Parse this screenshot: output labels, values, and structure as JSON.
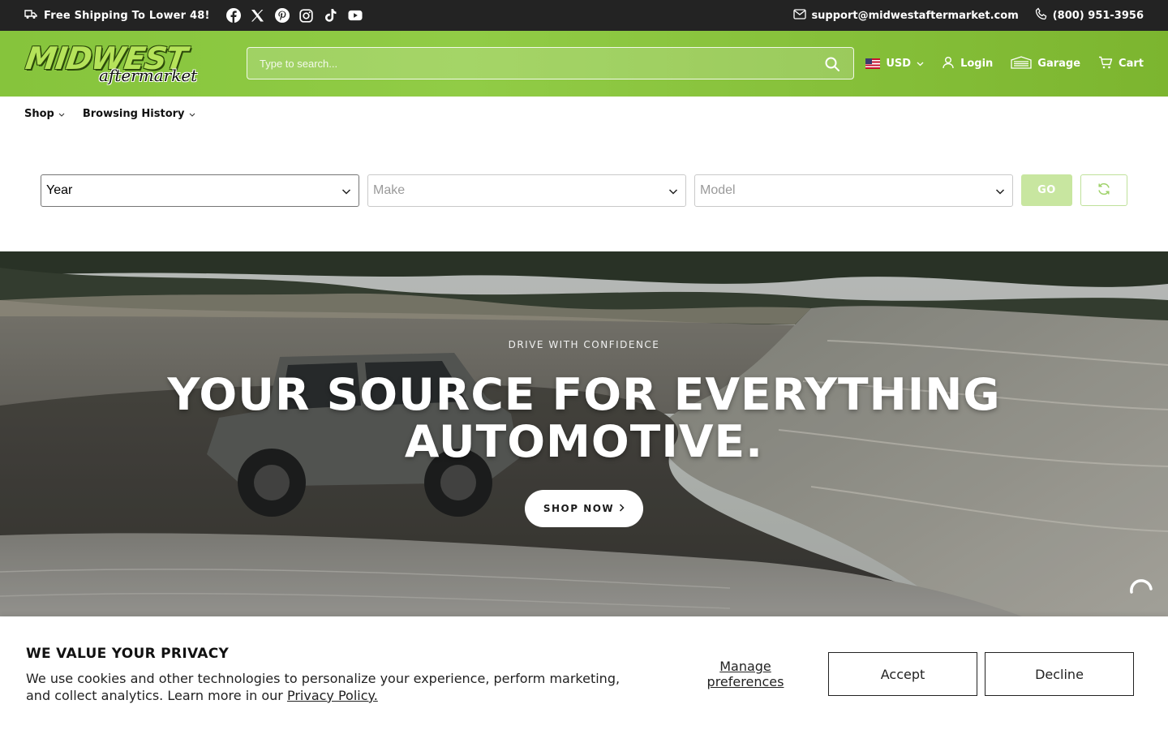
{
  "topbar": {
    "shipping_text": "Free Shipping To Lower 48!",
    "social_icons": [
      "facebook-icon",
      "x-icon",
      "pinterest-icon",
      "instagram-icon",
      "tiktok-icon",
      "youtube-icon"
    ],
    "email": "support@midwestaftermarket.com",
    "phone": "(800) 951-3956"
  },
  "header": {
    "logo_main": "MIDWEST",
    "logo_sub": "aftermarket",
    "search_placeholder": "Type to search...",
    "currency": "USD",
    "login_label": "Login",
    "garage_label": "Garage",
    "cart_label": "Cart"
  },
  "nav": {
    "items": [
      {
        "label": "Shop"
      },
      {
        "label": "Browsing History"
      }
    ]
  },
  "selector": {
    "year": "Year",
    "make": "Make",
    "model": "Model",
    "go_label": "GO"
  },
  "hero": {
    "eyebrow": "DRIVE WITH CONFIDENCE",
    "headline_line1": "YOUR SOURCE FOR EVERYTHING",
    "headline_line2": "AUTOMOTIVE.",
    "cta_label": "SHOP NOW"
  },
  "cookie": {
    "title": "WE VALUE YOUR PRIVACY",
    "text": "We use cookies and other technologies to personalize your experience, perform marketing, and collect analytics. Learn more in our ",
    "link": "Privacy Policy.",
    "manage_label": "Manage preferences",
    "accept_label": "Accept",
    "decline_label": "Decline"
  },
  "colors": {
    "brand_green": "#8cc63f",
    "topbar_bg": "#232323",
    "go_button_disabled": "#c8e6a0"
  }
}
